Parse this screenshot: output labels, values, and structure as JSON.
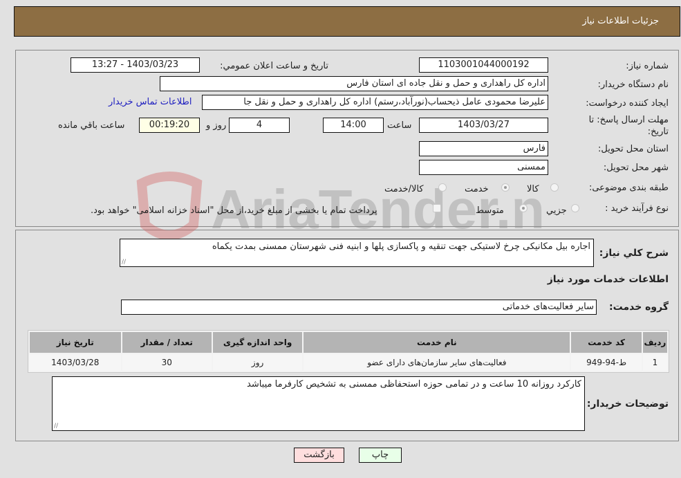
{
  "header": {
    "title": "جزئیات اطلاعات نیاز"
  },
  "fields": {
    "need_number_label": "شماره نیاز:",
    "need_number": "1103001044000192",
    "announce_label": "تاریخ و ساعت اعلان عمومي:",
    "announce_value": "1403/03/23 - 13:27",
    "buyer_org_label": "نام دستگاه خريدار:",
    "buyer_org": "اداره کل راهداری و حمل و نقل جاده ای استان فارس",
    "creator_label": "ایجاد کننده درخواست:",
    "creator": "علیرضا محمودی عامل ذیحساب(نورآباد،رستم) اداره کل راهداری و حمل و نقل جا",
    "contact_link": "اطلاعات تماس خريدار",
    "deadline_label": "مهلت ارسال پاسخ: تا تاریخ:",
    "deadline_date": "1403/03/27",
    "time_label": "ساعت",
    "deadline_time": "14:00",
    "days_value": "4",
    "days_label": "روز و",
    "remaining_time": "00:19:20",
    "remaining_label": "ساعت باقي مانده",
    "province_label": "استان محل تحویل:",
    "province": "فارس",
    "city_label": "شهر محل تحویل:",
    "city": "ممسنی",
    "category_label": "طبقه بندی موضوعی:",
    "category_options": [
      "کالا",
      "خدمت",
      "کالا/خدمت"
    ],
    "category_selected": "خدمت",
    "process_label": "نوع فرآیند خرید :",
    "process_options": [
      "جزيي",
      "متوسط"
    ],
    "process_selected": "متوسط",
    "treasury_note": "پرداخت تمام یا بخشی از مبلغ خرید،از محل \"اسناد خزانه اسلامی\" خواهد بود."
  },
  "description": {
    "label": "شرح کلي نياز:",
    "value": "اجاره بیل مکانیکی چرخ لاستیکی جهت تنقیه و پاکسازی پلها و ابنیه فنی شهرستان ممسنی بمدت یکماه"
  },
  "services": {
    "section_title": "اطلاعات خدمات مورد نیاز",
    "group_label": "گروه خدمت:",
    "group_value": "سایر فعالیت‌های خدماتی",
    "columns": [
      "رديف",
      "کد خدمت",
      "نام خدمت",
      "واحد اندازه گیری",
      "تعداد / مقدار",
      "تاریخ نیاز"
    ],
    "rows": [
      [
        "1",
        "ط-94-949",
        "فعالیت‌های سایر سازمان‌های دارای عضو",
        "روز",
        "30",
        "1403/03/28"
      ]
    ]
  },
  "buyer_notes": {
    "label": "توضیحات خریدار:",
    "value": "کارکرد روزانه 10 ساعت و در تمامی حوزه استحفاظی ممسنی به تشخیص کارفرما میباشد"
  },
  "buttons": {
    "print": "چاپ",
    "back": "بازگشت"
  },
  "watermark": {
    "text": "AriaTender.neT"
  },
  "colors": {
    "header": "#8d6e43",
    "print_bg": "#e8ffe8",
    "back_bg": "#ffdede",
    "remaining_bg": "#ffffe6",
    "link": "#2020c0"
  }
}
